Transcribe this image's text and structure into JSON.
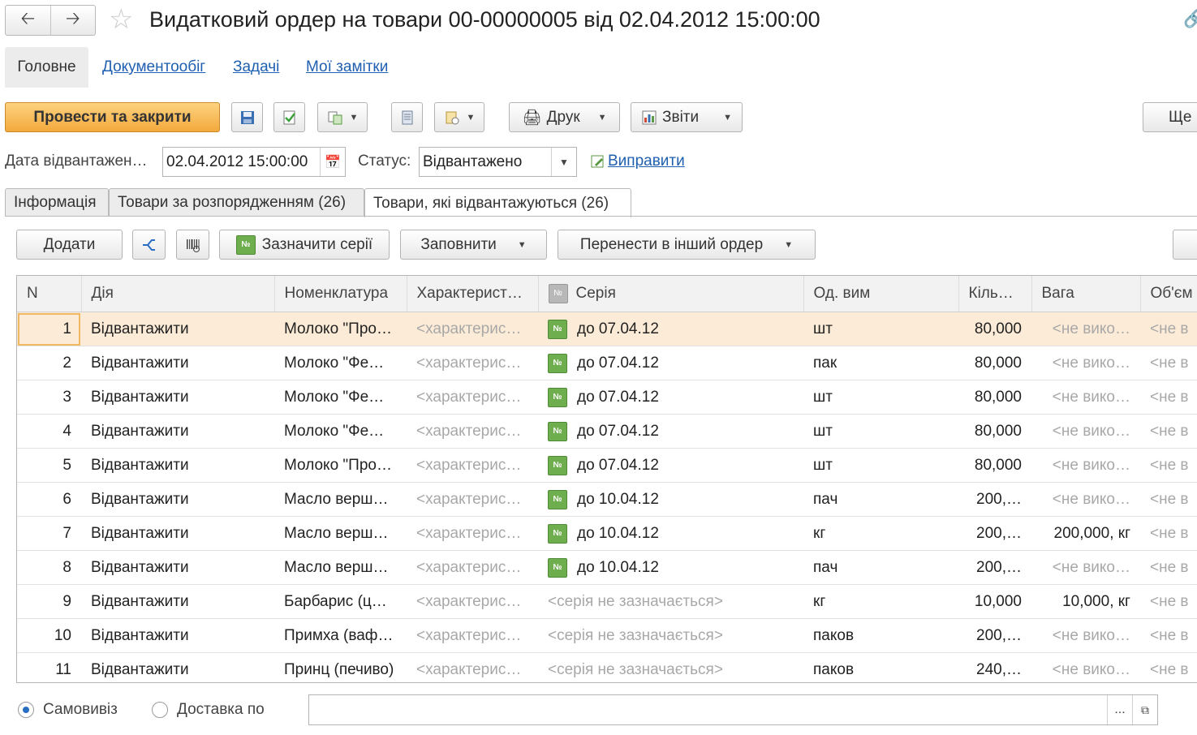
{
  "window": {
    "title": "Видатковий ордер на товари 00-00000005 від 02.04.2012 15:00:00"
  },
  "sections": [
    {
      "label": "Головне",
      "active": true
    },
    {
      "label": "Документообіг"
    },
    {
      "label": "Задачі"
    },
    {
      "label": "Мої замітки"
    }
  ],
  "toolbar": {
    "post_close": "Провести та закрити",
    "print": "Друк",
    "reports": "Звіти",
    "more": "Ще"
  },
  "form": {
    "ship_date_label": "Дата відвантажен…",
    "ship_date_value": "02.04.2012 15:00:00",
    "status_label": "Статус:",
    "status_value": "Відвантажено",
    "fix_link": "Виправити"
  },
  "tabs": [
    {
      "label": "Інформація"
    },
    {
      "label": "Товари за розпорядженням (26)"
    },
    {
      "label": "Товари, які відвантажуються (26)",
      "active": true
    }
  ],
  "grid_toolbar": {
    "add": "Додати",
    "mark_series": "Зазначити серії",
    "fill": "Заповнити",
    "move": "Перенести в інший ордер"
  },
  "table": {
    "columns": [
      "N",
      "Дія",
      "Номенклатура",
      "Характерист…",
      "Серія",
      "Од. вим",
      "Кіль…",
      "Вага",
      "Об'єм"
    ],
    "rows": [
      {
        "n": "1",
        "action": "Відвантажити",
        "item": "Молоко \"Про…",
        "char": "<характерис…",
        "series": "до 07.04.12",
        "series_icon": true,
        "unit": "шт",
        "qty": "80,000",
        "weight": "<не вико…",
        "weight_gray": true,
        "volume": "<не в",
        "selected": true
      },
      {
        "n": "2",
        "action": "Відвантажити",
        "item": "Молоко \"Фе…",
        "char": "<характерис…",
        "series": "до 07.04.12",
        "series_icon": true,
        "unit": "пак",
        "qty": "80,000",
        "weight": "<не вико…",
        "weight_gray": true,
        "volume": "<не в"
      },
      {
        "n": "3",
        "action": "Відвантажити",
        "item": "Молоко \"Фе…",
        "char": "<характерис…",
        "series": "до 07.04.12",
        "series_icon": true,
        "unit": "шт",
        "qty": "80,000",
        "weight": "<не вико…",
        "weight_gray": true,
        "volume": "<не в"
      },
      {
        "n": "4",
        "action": "Відвантажити",
        "item": "Молоко \"Фе…",
        "char": "<характерис…",
        "series": "до 07.04.12",
        "series_icon": true,
        "unit": "шт",
        "qty": "80,000",
        "weight": "<не вико…",
        "weight_gray": true,
        "volume": "<не в"
      },
      {
        "n": "5",
        "action": "Відвантажити",
        "item": "Молоко \"Про…",
        "char": "<характерис…",
        "series": "до 07.04.12",
        "series_icon": true,
        "unit": "шт",
        "qty": "80,000",
        "weight": "<не вико…",
        "weight_gray": true,
        "volume": "<не в"
      },
      {
        "n": "6",
        "action": "Відвантажити",
        "item": "Масло верш…",
        "char": "<характерис…",
        "series": "до 10.04.12",
        "series_icon": true,
        "unit": "пач",
        "qty": "200,…",
        "weight": "<не вико…",
        "weight_gray": true,
        "volume": "<не в"
      },
      {
        "n": "7",
        "action": "Відвантажити",
        "item": "Масло верш…",
        "char": "<характерис…",
        "series": "до 10.04.12",
        "series_icon": true,
        "unit": "кг",
        "qty": "200,…",
        "weight": "200,000, кг",
        "weight_gray": false,
        "volume": "<не в"
      },
      {
        "n": "8",
        "action": "Відвантажити",
        "item": "Масло верш…",
        "char": "<характерис…",
        "series": "до 10.04.12",
        "series_icon": true,
        "unit": "пач",
        "qty": "200,…",
        "weight": "<не вико…",
        "weight_gray": true,
        "volume": "<не в"
      },
      {
        "n": "9",
        "action": "Відвантажити",
        "item": "Барбарис (ц…",
        "char": "<характерис…",
        "series": "<серія не зазначається>",
        "series_icon": false,
        "unit": "кг",
        "qty": "10,000",
        "weight": "10,000, кг",
        "weight_gray": false,
        "volume": "<не в"
      },
      {
        "n": "10",
        "action": "Відвантажити",
        "item": "Примха (ваф…",
        "char": "<характерис…",
        "series": "<серія не зазначається>",
        "series_icon": false,
        "unit": "паков",
        "qty": "200,…",
        "weight": "<не вико…",
        "weight_gray": true,
        "volume": "<не в"
      },
      {
        "n": "11",
        "action": "Відвантажити",
        "item": "Принц (печиво)",
        "char": "<характерис…",
        "series": "<серія не зазначається>",
        "series_icon": false,
        "unit": "паков",
        "qty": "240,…",
        "weight": "<не вико…",
        "weight_gray": true,
        "volume": "<не в"
      }
    ]
  },
  "delivery": {
    "pickup_label": "Самовивіз",
    "pickup_selected": true,
    "delivery_label": "Доставка по",
    "address_value": "",
    "select_button": "..."
  }
}
